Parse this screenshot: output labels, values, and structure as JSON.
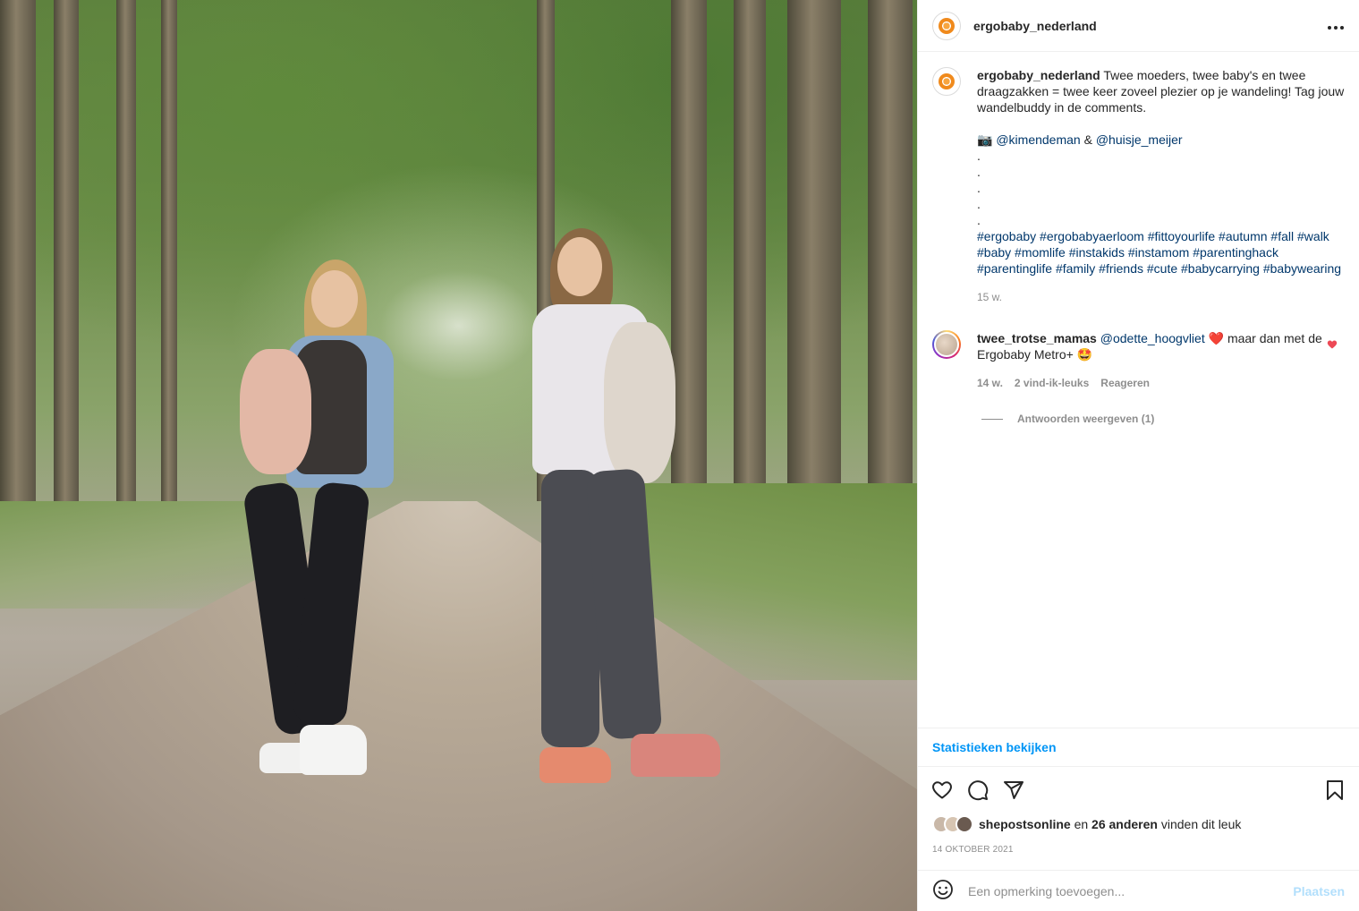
{
  "post": {
    "username": "ergobaby_nederland",
    "more_icon": "more-horizontal-icon"
  },
  "caption": {
    "username": "ergobaby_nederland",
    "text": "Twee moeders, twee baby's en twee draagzakken = twee keer zoveel plezier op je wandeling! Tag jouw wandelbuddy in de comments.",
    "camera_emoji": "📷",
    "mention_1": "@kimendeman",
    "amp": "&",
    "mention_2": "@huisje_meijer",
    "dots": [
      ".",
      ".",
      ".",
      ".",
      "."
    ],
    "hashtags": "#ergobaby #ergobabyaerloom #fittoyourlife #autumn #fall #walk #baby #momlife #instakids #instamom #parentinghack #parentinglife #family #friends #cute #babycarrying #babywearing",
    "time": "15 w."
  },
  "reply": {
    "username": "twee_trotse_mamas",
    "mention": "@odette_hoogvliet",
    "heart_emoji": "❤️",
    "text": "maar dan met de Ergobaby Metro+",
    "emoji_end": "🤩",
    "time": "14 w.",
    "likes": "2 vind-ik-leuks",
    "reply_label": "Reageren",
    "view_replies": "Antwoorden weergeven (1)"
  },
  "stats_link": "Statistieken bekijken",
  "likes": {
    "user": "shepostsonline",
    "connector": "en",
    "others": "26 anderen",
    "suffix": "vinden dit leuk"
  },
  "date": "14 OKTOBER 2021",
  "add_comment": {
    "placeholder": "Een opmerking toevoegen...",
    "post_label": "Plaatsen"
  },
  "colors": {
    "link": "#00376b",
    "accent": "#0095f6",
    "muted": "#8e8e8e",
    "like_red": "#ed4956"
  }
}
